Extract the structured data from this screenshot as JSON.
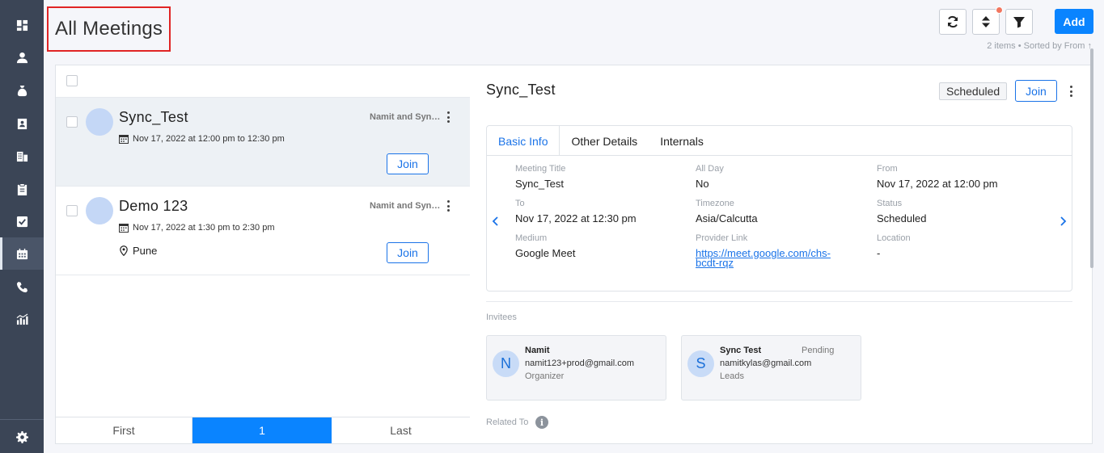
{
  "page": {
    "title": "All Meetings"
  },
  "header": {
    "add_label": "Add",
    "sort_info": "2 items • Sorted by From ↑"
  },
  "sidebar": {
    "items": [
      {
        "icon": "dashboard-icon"
      },
      {
        "icon": "user-icon"
      },
      {
        "icon": "money-bag-icon"
      },
      {
        "icon": "contact-card-icon"
      },
      {
        "icon": "building-icon"
      },
      {
        "icon": "clipboard-icon"
      },
      {
        "icon": "task-check-icon"
      },
      {
        "icon": "calendar-icon",
        "active": true
      },
      {
        "icon": "phone-icon"
      },
      {
        "icon": "reports-icon"
      }
    ],
    "settings_icon": "gear-icon"
  },
  "list": {
    "items": [
      {
        "title": "Sync_Test",
        "organizer": "Namit and Sync Test",
        "datetime": "Nov 17, 2022 at 12:00 pm to 12:30 pm",
        "location": "",
        "join_label": "Join"
      },
      {
        "title": "Demo 123",
        "organizer": "Namit and Sync Test",
        "datetime": "Nov 17, 2022 at 1:30 pm to 2:30 pm",
        "location": "Pune",
        "join_label": "Join"
      }
    ],
    "pager": {
      "first": "First",
      "current": "1",
      "last": "Last"
    }
  },
  "detail": {
    "title": "Sync_Test",
    "status": "Scheduled",
    "join_label": "Join",
    "tabs": [
      "Basic Info",
      "Other Details",
      "Internals"
    ],
    "fields": {
      "meeting_title": {
        "label": "Meeting Title",
        "value": "Sync_Test"
      },
      "all_day": {
        "label": "All Day",
        "value": "No"
      },
      "from": {
        "label": "From",
        "value": "Nov 17, 2022 at 12:00 pm"
      },
      "to": {
        "label": "To",
        "value": "Nov 17, 2022 at 12:30 pm"
      },
      "timezone": {
        "label": "Timezone",
        "value": "Asia/Calcutta"
      },
      "status": {
        "label": "Status",
        "value": "Scheduled"
      },
      "medium": {
        "label": "Medium",
        "value": "Google Meet"
      },
      "provider_link": {
        "label": "Provider Link",
        "value": "https://meet.google.com/chs-bcdt-rqz"
      },
      "location": {
        "label": "Location",
        "value": "-"
      }
    },
    "invitees_label": "Invitees",
    "invitees": [
      {
        "initial": "N",
        "name": "Namit",
        "email": "namit123+prod@gmail.com",
        "role": "Organizer",
        "status": ""
      },
      {
        "initial": "S",
        "name": "Sync Test",
        "email": "namitkylas@gmail.com",
        "role": "Leads",
        "status": "Pending"
      }
    ],
    "related_label": "Related To"
  },
  "colors": {
    "primary": "#0a84ff",
    "sidebar": "#3b4556",
    "highlight_border": "#e02424"
  }
}
